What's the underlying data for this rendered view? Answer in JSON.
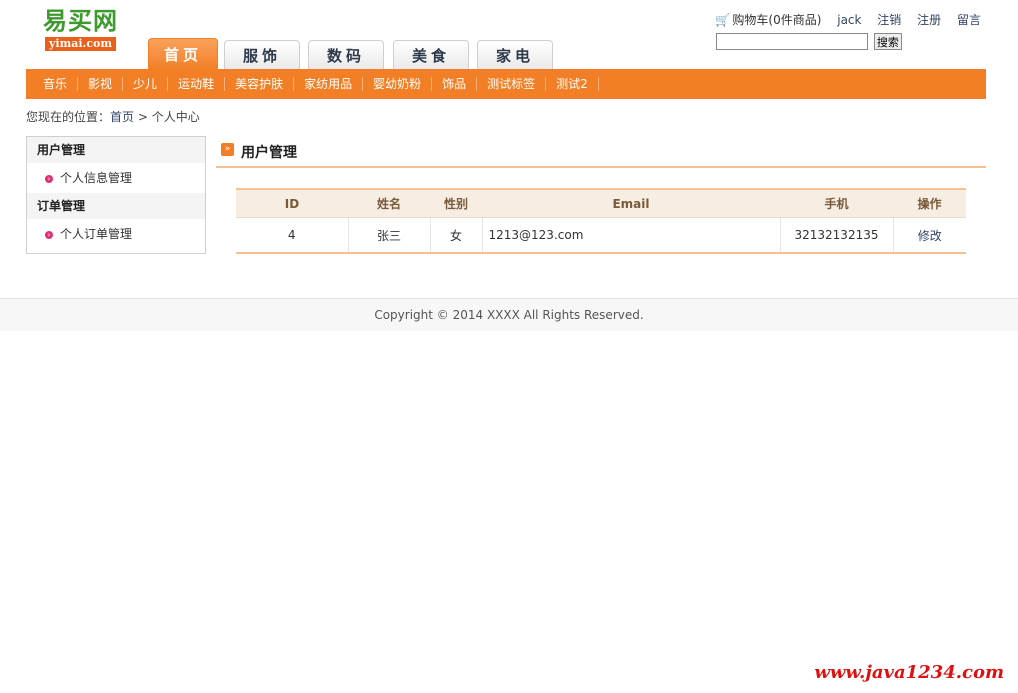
{
  "logo": {
    "cn": "易买网",
    "en": "yimai.com"
  },
  "tabs": [
    {
      "label": "首页"
    },
    {
      "label": "服饰"
    },
    {
      "label": "数码"
    },
    {
      "label": "美食"
    },
    {
      "label": "家电"
    }
  ],
  "topbar": {
    "cart": "购物车(0件商品)",
    "user": "jack",
    "logout": "注销",
    "register": "注册",
    "message": "留言",
    "search_button": "搜索",
    "search_value": ""
  },
  "categories": [
    "音乐",
    "影视",
    "少儿",
    "运动鞋",
    "美容护肤",
    "家纺用品",
    "婴幼奶粉",
    "饰品",
    "测试标签",
    "测试2"
  ],
  "breadcrumb": {
    "prefix": "您现在的位置：",
    "home": "首页",
    "sep": " > ",
    "current": "个人中心"
  },
  "sidebar": {
    "groups": [
      {
        "title": "用户管理",
        "item": "个人信息管理"
      },
      {
        "title": "订单管理",
        "item": "个人订单管理"
      }
    ]
  },
  "main": {
    "title": "用户管理",
    "columns": [
      "ID",
      "姓名",
      "性别",
      "Email",
      "手机",
      "操作"
    ],
    "rows": [
      {
        "id": "4",
        "name": "张三",
        "gender": "女",
        "email": "1213@123.com",
        "phone": "32132132135",
        "action": "修改"
      }
    ]
  },
  "footer": "Copyright © 2014 XXXX All Rights Reserved.",
  "watermark": "www.java1234.com",
  "colors": {
    "accent": "#f27f25",
    "logo_green": "#3f9a2e",
    "link": "#334466",
    "table_header": "#f6eee3"
  }
}
